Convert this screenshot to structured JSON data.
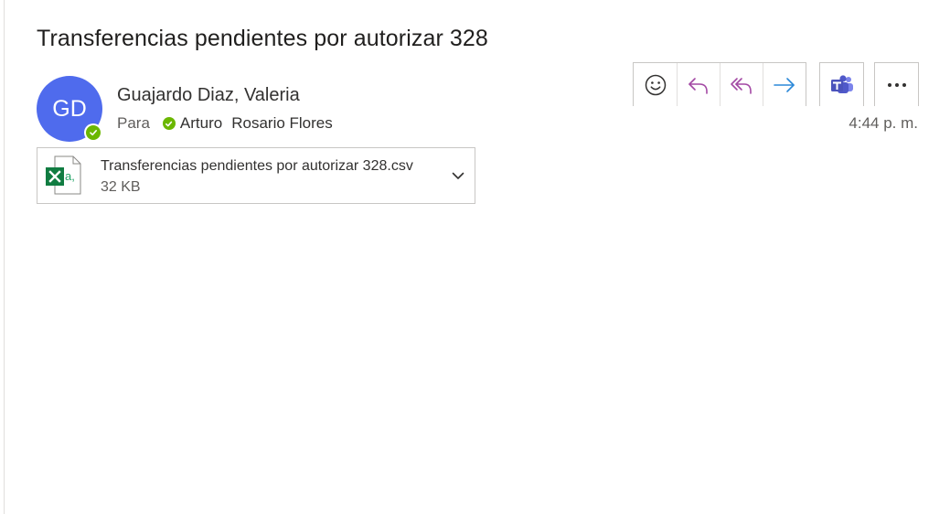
{
  "email": {
    "subject": "Transferencias pendientes por autorizar 328",
    "sender": {
      "name": "Guajardo Diaz, Valeria",
      "initials": "GD",
      "avatar_color": "#4f6bed",
      "presence": "available"
    },
    "to_label": "Para",
    "recipient": {
      "first": "Arturo",
      "last": "Rosario Flores",
      "presence": "available"
    },
    "time": "4:44 p. m."
  },
  "actions": [
    {
      "name": "react",
      "icon": "smiley-icon"
    },
    {
      "name": "reply",
      "icon": "reply-icon"
    },
    {
      "name": "reply-all",
      "icon": "reply-all-icon"
    },
    {
      "name": "forward",
      "icon": "forward-arrow-icon"
    },
    {
      "name": "teams",
      "icon": "teams-icon"
    },
    {
      "name": "more",
      "icon": "more-icon"
    }
  ],
  "attachment": {
    "name": "Transferencias pendientes por autorizar 328.csv",
    "size": "32 KB",
    "icon": "excel-csv-icon"
  },
  "colors": {
    "accent_purple": "#a349a4",
    "forward_blue": "#2b88d8",
    "presence_green": "#6bb700",
    "excel_green": "#107c41"
  }
}
